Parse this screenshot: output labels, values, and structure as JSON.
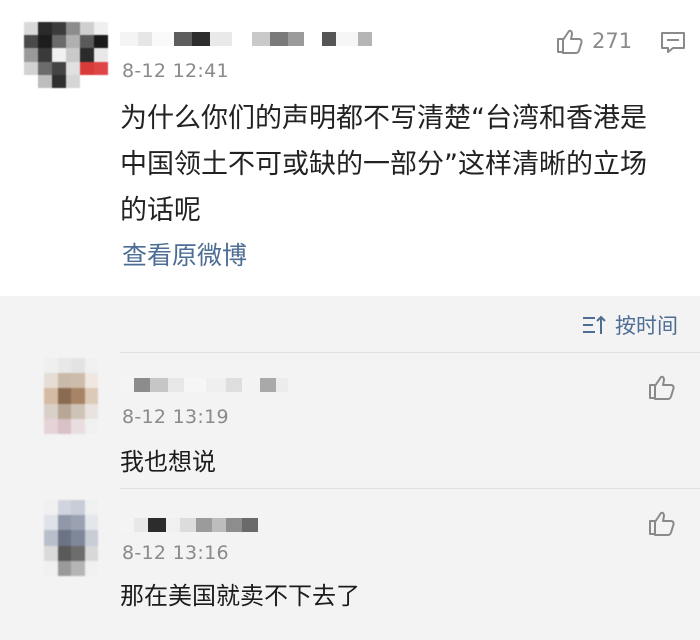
{
  "post": {
    "time": "8-12 12:41",
    "like_count": "271",
    "lines": [
      "为什么你们的声明都不写清楚“台湾和香港是",
      "中国领土不可或缺的一部分”这样清晰的立场",
      "的话呢"
    ],
    "view_original": "查看原微博"
  },
  "sort": {
    "label": "按时间"
  },
  "replies": [
    {
      "time": "8-12 13:19",
      "text": "我也想说"
    },
    {
      "time": "8-12 13:16",
      "text": "那在美国就卖不下去了"
    }
  ],
  "icons": {
    "like": "thumbs-up-icon",
    "comment": "comment-icon",
    "sort": "sort-icon"
  },
  "colors": {
    "link": "#4d6d94",
    "secondary_text": "#8a8a8a",
    "background": "#f3f3f3"
  }
}
